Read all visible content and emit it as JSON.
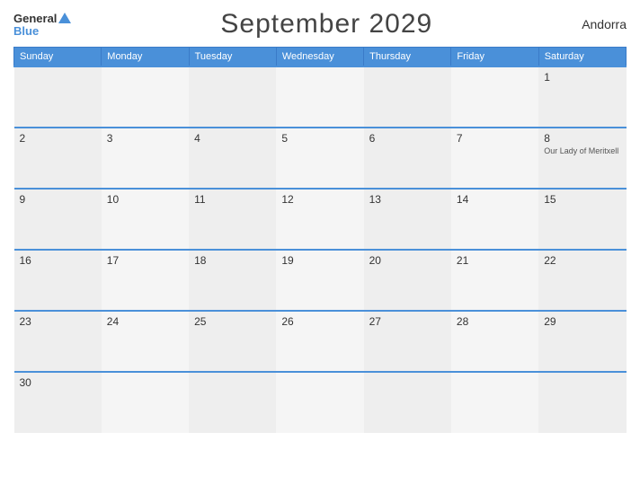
{
  "header": {
    "title": "September 2029",
    "country": "Andorra",
    "logo_general": "General",
    "logo_blue": "Blue"
  },
  "days_of_week": [
    "Sunday",
    "Monday",
    "Tuesday",
    "Wednesday",
    "Thursday",
    "Friday",
    "Saturday"
  ],
  "weeks": [
    [
      {
        "day": "",
        "holiday": ""
      },
      {
        "day": "",
        "holiday": ""
      },
      {
        "day": "",
        "holiday": ""
      },
      {
        "day": "",
        "holiday": ""
      },
      {
        "day": "",
        "holiday": ""
      },
      {
        "day": "",
        "holiday": ""
      },
      {
        "day": "1",
        "holiday": ""
      }
    ],
    [
      {
        "day": "2",
        "holiday": ""
      },
      {
        "day": "3",
        "holiday": ""
      },
      {
        "day": "4",
        "holiday": ""
      },
      {
        "day": "5",
        "holiday": ""
      },
      {
        "day": "6",
        "holiday": ""
      },
      {
        "day": "7",
        "holiday": ""
      },
      {
        "day": "8",
        "holiday": "Our Lady of Meritxell"
      }
    ],
    [
      {
        "day": "9",
        "holiday": ""
      },
      {
        "day": "10",
        "holiday": ""
      },
      {
        "day": "11",
        "holiday": ""
      },
      {
        "day": "12",
        "holiday": ""
      },
      {
        "day": "13",
        "holiday": ""
      },
      {
        "day": "14",
        "holiday": ""
      },
      {
        "day": "15",
        "holiday": ""
      }
    ],
    [
      {
        "day": "16",
        "holiday": ""
      },
      {
        "day": "17",
        "holiday": ""
      },
      {
        "day": "18",
        "holiday": ""
      },
      {
        "day": "19",
        "holiday": ""
      },
      {
        "day": "20",
        "holiday": ""
      },
      {
        "day": "21",
        "holiday": ""
      },
      {
        "day": "22",
        "holiday": ""
      }
    ],
    [
      {
        "day": "23",
        "holiday": ""
      },
      {
        "day": "24",
        "holiday": ""
      },
      {
        "day": "25",
        "holiday": ""
      },
      {
        "day": "26",
        "holiday": ""
      },
      {
        "day": "27",
        "holiday": ""
      },
      {
        "day": "28",
        "holiday": ""
      },
      {
        "day": "29",
        "holiday": ""
      }
    ],
    [
      {
        "day": "30",
        "holiday": ""
      },
      {
        "day": "",
        "holiday": ""
      },
      {
        "day": "",
        "holiday": ""
      },
      {
        "day": "",
        "holiday": ""
      },
      {
        "day": "",
        "holiday": ""
      },
      {
        "day": "",
        "holiday": ""
      },
      {
        "day": "",
        "holiday": ""
      }
    ]
  ]
}
